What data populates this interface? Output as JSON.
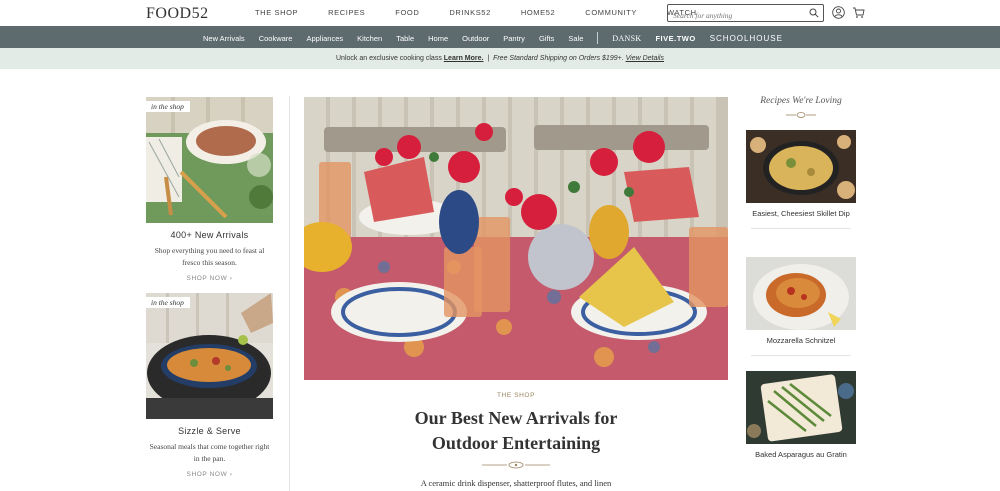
{
  "header": {
    "logo": "FOOD52",
    "nav": [
      "THE SHOP",
      "RECIPES",
      "FOOD",
      "DRINKS52",
      "HOME52",
      "COMMUNITY",
      "WATCH"
    ],
    "search_placeholder": "Search for anything"
  },
  "categories": {
    "items": [
      "New Arrivals",
      "Cookware",
      "Appliances",
      "Kitchen",
      "Table",
      "Home",
      "Outdoor",
      "Pantry",
      "Gifts",
      "Sale"
    ],
    "brands": [
      "DANSK",
      "FIVE.TWO",
      "SCHOOLHOUSE"
    ]
  },
  "promo": {
    "lead": "Unlock an exclusive cooking class",
    "learn_more": "Learn More.",
    "sep": "|",
    "shipping": "Free Standard Shipping on Orders $199+.",
    "view_details": "View Details"
  },
  "left_cards": [
    {
      "tag": "in the shop",
      "title": "400+ New Arrivals",
      "desc": "Shop everything you need to feast al fresco this season.",
      "cta": "SHOP NOW"
    },
    {
      "tag": "in the shop",
      "title": "Sizzle & Serve",
      "desc": "Seasonal meals that come together right in the pan.",
      "cta": "SHOP NOW"
    }
  ],
  "hero": {
    "kicker": "THE SHOP",
    "headline_line1": "Our Best New Arrivals for",
    "headline_line2": "Outdoor Entertaining",
    "subcopy": "A ceramic drink dispenser, shatterproof flutes, and linen"
  },
  "recipes": {
    "heading": "Recipes We're Loving",
    "items": [
      {
        "title": "Easiest, Cheesiest Skillet Dip"
      },
      {
        "title": "Mozzarella Schnitzel"
      },
      {
        "title": "Baked Asparagus au Gratin"
      }
    ]
  },
  "icons": {
    "search": "search-icon",
    "account": "account-icon",
    "cart": "cart-icon"
  },
  "colors": {
    "category_bar": "#5d6a6e",
    "promo_bar": "#e2ebe6",
    "kicker": "#9b8560"
  }
}
